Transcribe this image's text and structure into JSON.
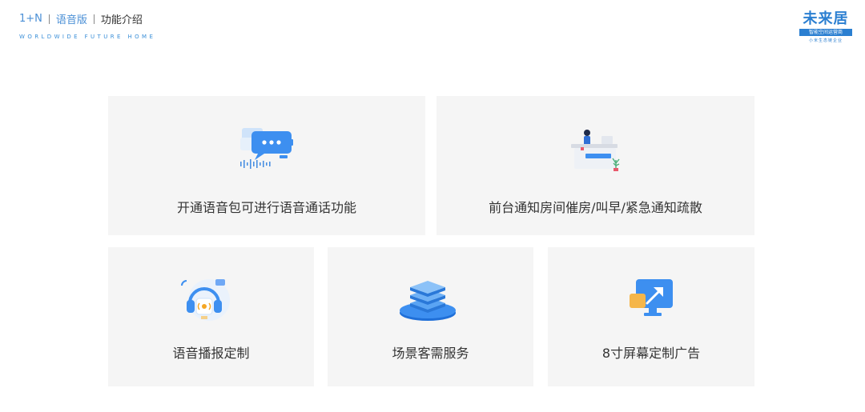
{
  "header": {
    "crumbs": [
      "1+N",
      "语音版",
      "功能介绍"
    ],
    "tagline": "WORLDWIDE FUTURE HOME"
  },
  "logo": {
    "title": "未来居",
    "band": "智能空间运营商",
    "sub": "小米生态链企业"
  },
  "colors": {
    "accent": "#2b7fd1",
    "card_bg": "#f5f5f5",
    "text": "#333333"
  },
  "features": [
    {
      "label": "开通语音包可进行语音通话功能",
      "icon": "chat-bubble-icon"
    },
    {
      "label": "前台通知房间催房/叫早/紧急通知疏散",
      "icon": "reception-desk-icon"
    },
    {
      "label": "语音播报定制",
      "icon": "headset-icon"
    },
    {
      "label": "场景客需服务",
      "icon": "server-stack-icon"
    },
    {
      "label": "8寸屏幕定制广告",
      "icon": "screen-cursor-icon"
    }
  ]
}
